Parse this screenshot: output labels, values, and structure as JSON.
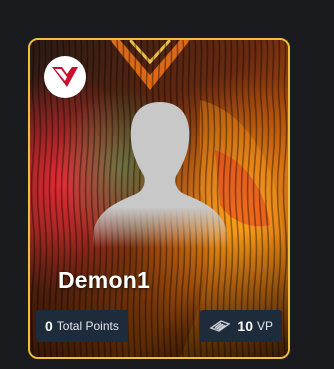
{
  "card": {
    "player_name": "Demon1",
    "points_value": "0",
    "points_label": "Total Points",
    "vp_value": "10",
    "vp_label": "VP",
    "brand_icon": "valorant-v-icon",
    "avatar_icon": "default-avatar-silhouette-icon",
    "vp_icon": "valorant-points-icon"
  },
  "colors": {
    "page_background": "#1a1b1f",
    "card_border": "#f0bd3f",
    "stat_pill_background": "#1e2b3a",
    "text": "#ffffff"
  }
}
